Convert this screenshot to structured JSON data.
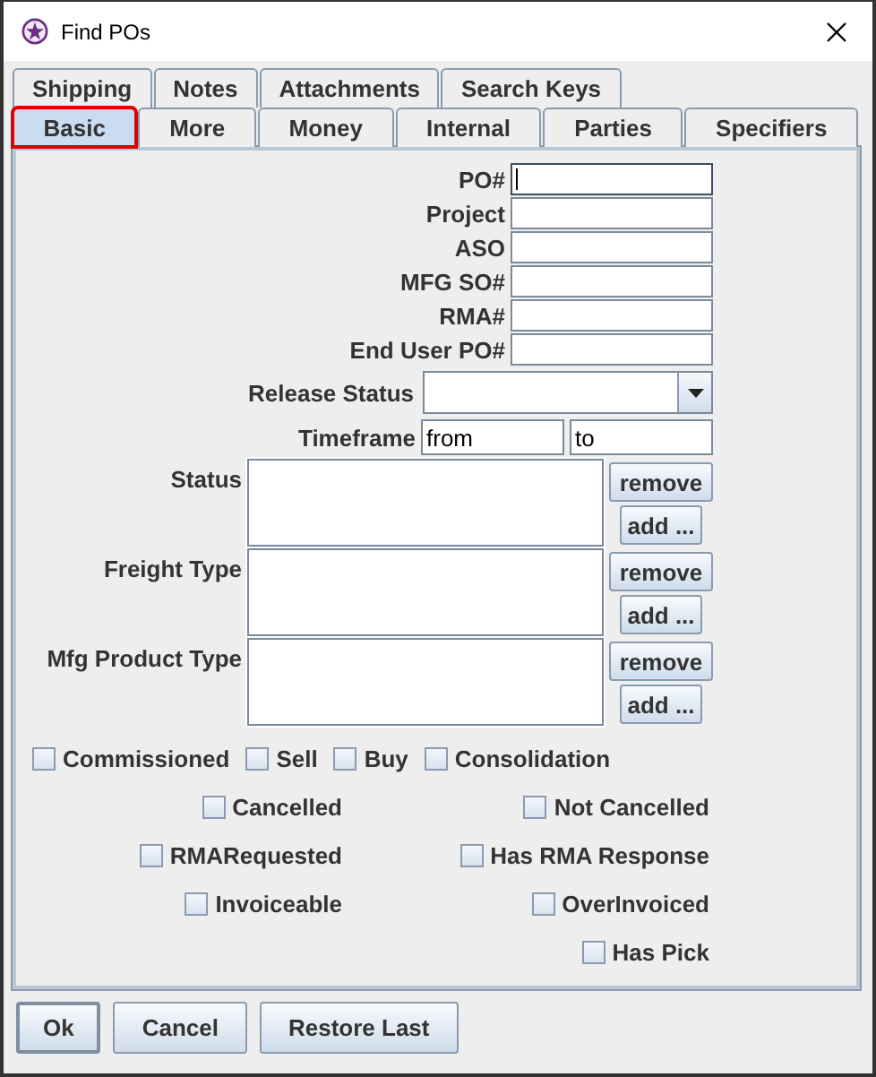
{
  "window": {
    "title": "Find POs"
  },
  "tab_rows": [
    [
      {
        "label": "Shipping",
        "selected": false,
        "focused": false
      },
      {
        "label": "Notes",
        "selected": false,
        "focused": false
      },
      {
        "label": "Attachments",
        "selected": false,
        "focused": false
      },
      {
        "label": "Search Keys",
        "selected": false,
        "focused": false
      }
    ],
    [
      {
        "label": "Basic",
        "selected": true,
        "focused": true
      },
      {
        "label": "More",
        "selected": false,
        "focused": false
      },
      {
        "label": "Money",
        "selected": false,
        "focused": false
      },
      {
        "label": "Internal",
        "selected": false,
        "focused": false
      },
      {
        "label": "Parties",
        "selected": false,
        "focused": false
      },
      {
        "label": "Specifiers",
        "selected": false,
        "focused": false
      }
    ]
  ],
  "fields": [
    {
      "kind": "text",
      "label": "PO#",
      "focused": true
    },
    {
      "kind": "text",
      "label": "Project",
      "focused": false
    },
    {
      "kind": "text",
      "label": "ASO",
      "focused": false
    },
    {
      "kind": "text",
      "label": "MFG SO#",
      "focused": false
    },
    {
      "kind": "text",
      "label": "RMA#",
      "focused": false
    },
    {
      "kind": "text",
      "label": "End User PO#",
      "focused": false
    },
    {
      "kind": "combo",
      "label": "Release Status"
    },
    {
      "kind": "range",
      "label": "Timeframe",
      "from": "from",
      "to": "to"
    },
    {
      "kind": "list",
      "label": "Status",
      "buttons": [
        "remove",
        "add ..."
      ]
    },
    {
      "kind": "list",
      "label": "Freight Type",
      "buttons": [
        "remove",
        "add ..."
      ]
    },
    {
      "kind": "list",
      "label": "Mfg Product Type",
      "buttons": [
        "remove",
        "add ..."
      ]
    }
  ],
  "flag_row": [
    {
      "label": "Commissioned",
      "checked": false
    },
    {
      "label": "Sell",
      "checked": false
    },
    {
      "label": "Buy",
      "checked": false
    },
    {
      "label": "Consolidation",
      "checked": false
    }
  ],
  "flag_pairs": [
    {
      "left": {
        "label": "Cancelled",
        "checked": false
      },
      "right": {
        "label": "Not Cancelled",
        "checked": false
      }
    },
    {
      "left": {
        "label": "RMARequested",
        "checked": false
      },
      "right": {
        "label": "Has RMA Response",
        "checked": false
      }
    },
    {
      "left": {
        "label": "Invoiceable",
        "checked": false
      },
      "right": {
        "label": "OverInvoiced",
        "checked": false
      }
    },
    {
      "right": {
        "label": "Has Pick",
        "checked": false
      }
    }
  ],
  "buttons": [
    {
      "label": "Ok",
      "default": true
    },
    {
      "label": "Cancel",
      "default": false
    },
    {
      "label": "Restore Last",
      "default": false
    }
  ]
}
